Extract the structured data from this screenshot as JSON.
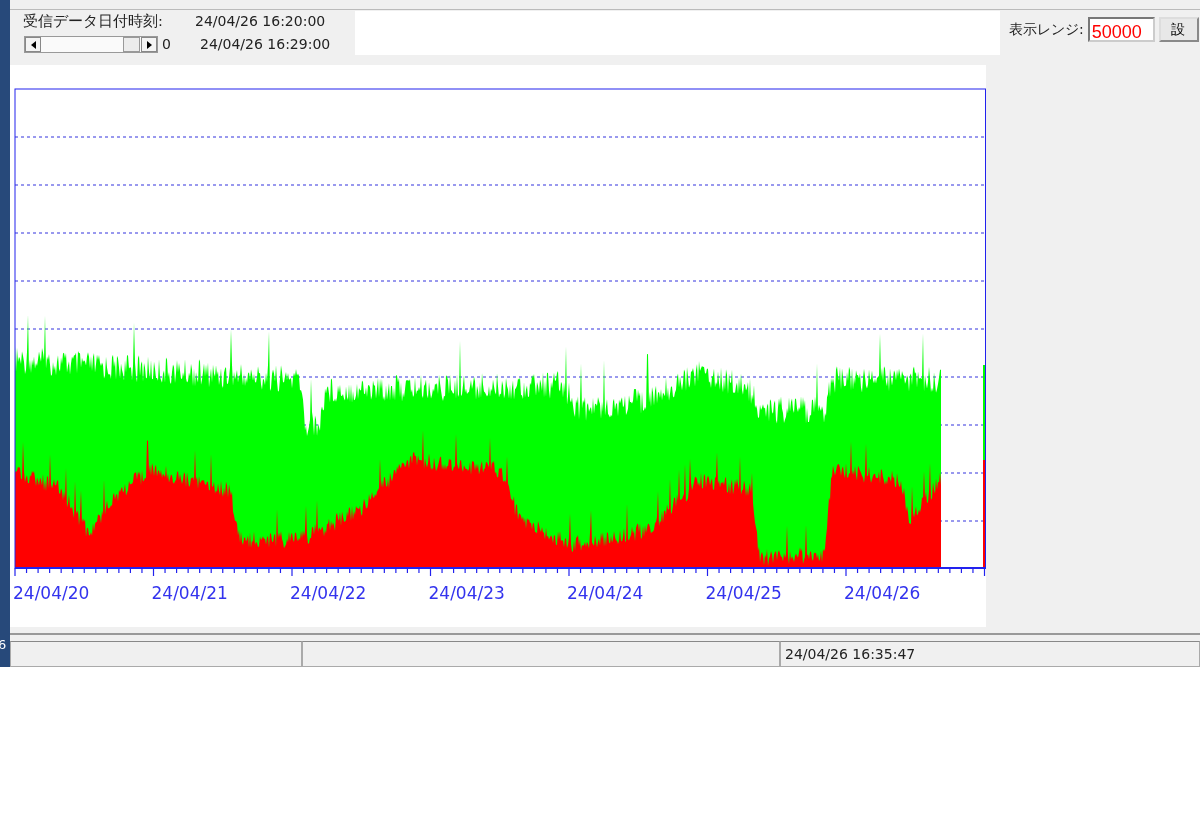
{
  "edge_text": "6",
  "header": {
    "received_label": "受信データ日付時刻:",
    "start_time": "24/04/26 16:20:00",
    "end_time": "24/04/26 16:29:00",
    "scroll_value": "0"
  },
  "range": {
    "label": "表示レンジ:",
    "value": "50000",
    "button": "設"
  },
  "chart": {
    "x_labels": [
      "24/04/20",
      "24/04/21",
      "24/04/22",
      "24/04/23",
      "24/04/24",
      "24/04/25",
      "24/04/26"
    ]
  },
  "status_bar": {
    "time": "24/04/26 16:35:47"
  }
}
